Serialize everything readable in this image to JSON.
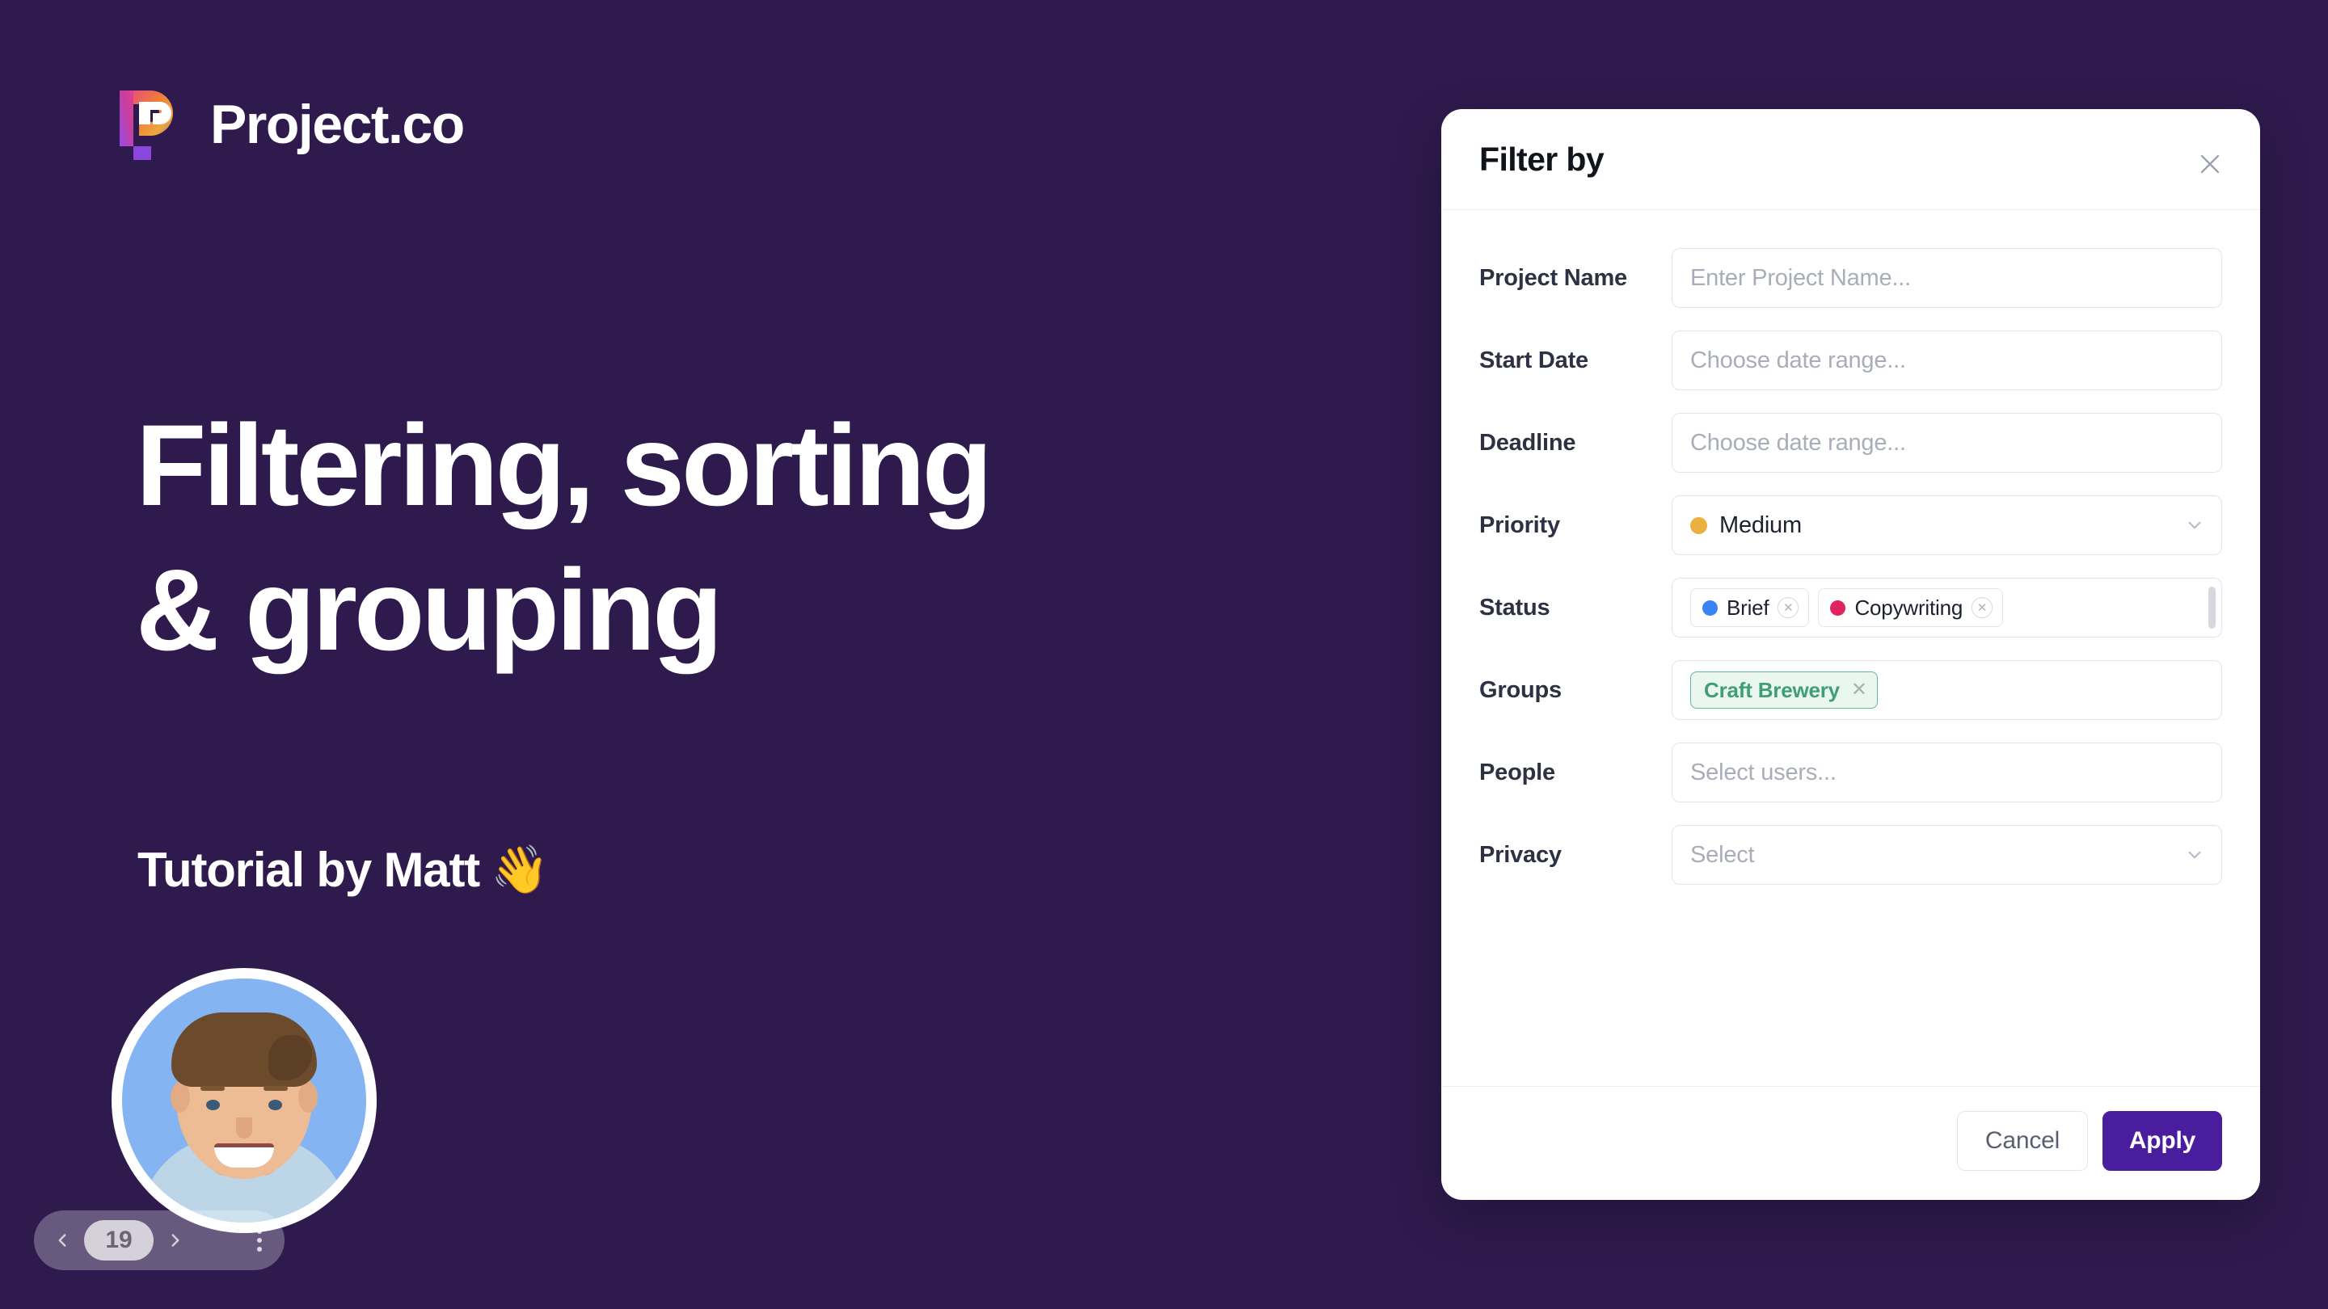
{
  "brand": {
    "name": "Project.co",
    "logo_icon": "project-co-p-mark"
  },
  "headline": {
    "line1": "Filtering, sorting",
    "line2": "& grouping"
  },
  "subtitle": {
    "text": "Tutorial by Matt",
    "emoji": "👋"
  },
  "pager": {
    "prev_icon": "chevron-left-icon",
    "next_icon": "chevron-right-icon",
    "count": "19",
    "menu_icon": "more-vertical-icon"
  },
  "filter_panel": {
    "title": "Filter by",
    "close_icon": "close-icon",
    "fields": {
      "project_name": {
        "label": "Project Name",
        "placeholder": "Enter Project Name...",
        "value": ""
      },
      "start_date": {
        "label": "Start Date",
        "placeholder": "Choose date range...",
        "value": ""
      },
      "deadline": {
        "label": "Deadline",
        "placeholder": "Choose date range...",
        "value": ""
      },
      "priority": {
        "label": "Priority",
        "value": "Medium",
        "dot_color": "#eab040",
        "chevron_icon": "chevron-down-icon"
      },
      "status": {
        "label": "Status",
        "chips": [
          {
            "label": "Brief",
            "dot_color": "#3b82f6",
            "remove_icon": "circle-x-icon"
          },
          {
            "label": "Copywriting",
            "dot_color": "#e0245e",
            "remove_icon": "circle-x-icon"
          }
        ]
      },
      "groups": {
        "label": "Groups",
        "chips": [
          {
            "label": "Craft Brewery",
            "remove_icon": "x-icon"
          }
        ],
        "chip_color": "#3f9e75",
        "chip_bg": "#eaf7f0"
      },
      "people": {
        "label": "People",
        "placeholder": "Select users...",
        "value": ""
      },
      "privacy": {
        "label": "Privacy",
        "placeholder": "Select",
        "value": "",
        "chevron_icon": "chevron-down-icon"
      }
    },
    "footer": {
      "cancel_label": "Cancel",
      "apply_label": "Apply",
      "apply_color": "#4a1d9e"
    }
  },
  "theme": {
    "background": "#2e1a4d",
    "card_background": "#ffffff",
    "text_on_dark": "#ffffff"
  }
}
